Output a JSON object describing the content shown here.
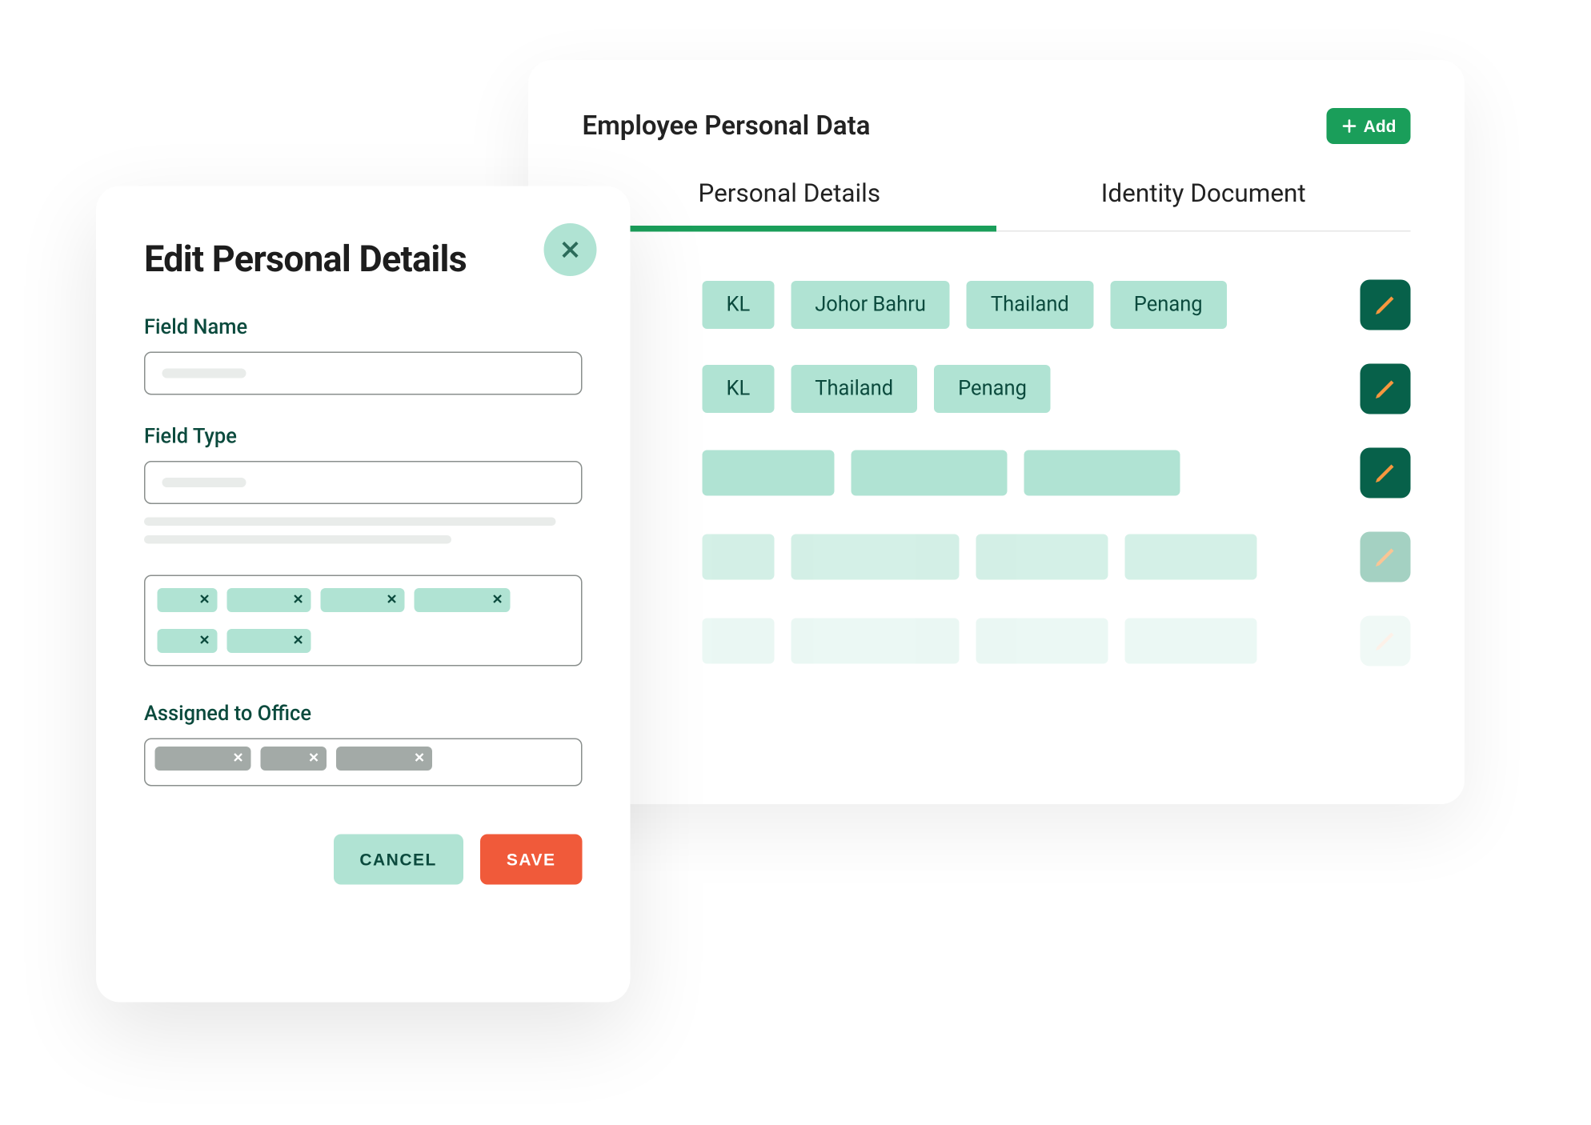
{
  "main": {
    "title": "Employee Personal Data",
    "add_label": "Add",
    "tabs": [
      {
        "label": "Personal Details",
        "active": true
      },
      {
        "label": "Identity Document",
        "active": false
      }
    ],
    "rows": [
      {
        "tags": [
          "KL",
          "Johor Bahru",
          "Thailand",
          "Penang"
        ],
        "has_edit": true
      },
      {
        "tags": [
          "KL",
          "Thailand",
          "Penang"
        ],
        "has_edit": true
      }
    ],
    "placeholder_rows": [
      {
        "widths": [
          110,
          130,
          130,
          110
        ],
        "opacity": "full"
      },
      {
        "widths": [
          60,
          140,
          110,
          110
        ],
        "opacity": "faded-1"
      },
      {
        "widths": [
          60,
          140,
          110,
          110
        ],
        "opacity": "faded-2"
      }
    ]
  },
  "modal": {
    "title": "Edit Personal Details",
    "field_name_label": "Field Name",
    "field_type_label": "Field  Type",
    "assigned_label": "Assigned to Office",
    "chip_widths_green": [
      50,
      70,
      70,
      80,
      50,
      70
    ],
    "chip_widths_grey": [
      80,
      55,
      80
    ],
    "cancel_label": "CANCEL",
    "save_label": "SAVE"
  }
}
